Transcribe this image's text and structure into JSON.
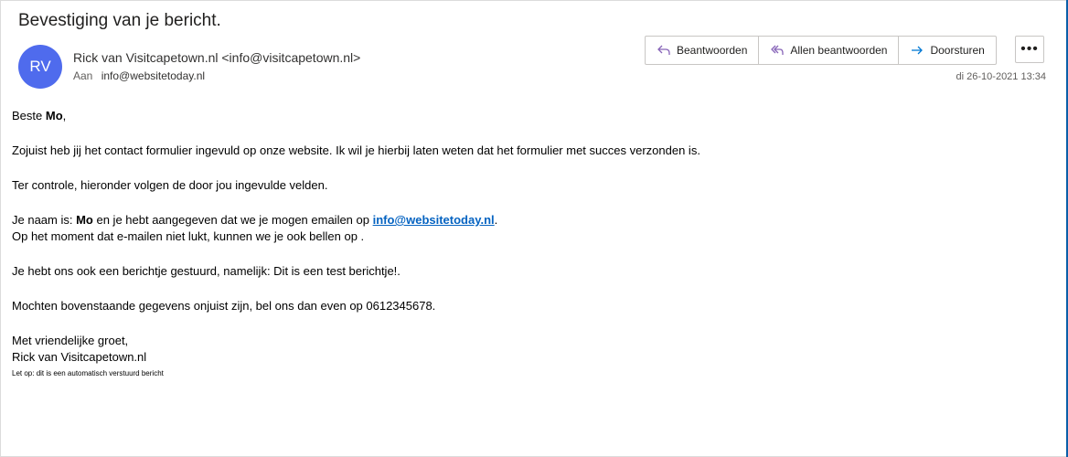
{
  "subject": "Bevestiging van je bericht.",
  "sender": {
    "initials": "RV",
    "display": "Rick van Visitcapetown.nl <info@visitcapetown.nl>",
    "to_label": "Aan",
    "to_address": "info@websitetoday.nl",
    "date": "di 26-10-2021 13:34"
  },
  "actions": {
    "reply": "Beantwoorden",
    "reply_all": "Allen beantwoorden",
    "forward": "Doorsturen",
    "more": "•••"
  },
  "colors": {
    "avatar": "#4f6bed",
    "reply_icon": "#8764b8",
    "forward_icon": "#0078d4",
    "link": "#0563c1"
  },
  "body": {
    "greeting_prefix": "Beste ",
    "name": "Mo",
    "greeting_suffix": ",",
    "line1": "Zojuist heb jij het contact formulier ingevuld op onze website. Ik wil je hierbij laten weten dat het formulier met succes verzonden is.",
    "line2": "Ter controle, hieronder volgen de door jou ingevulde velden.",
    "naam_prefix": "Je naam is: ",
    "naam_mid": " en je hebt aangegeven dat we je mogen emailen op ",
    "email_link": "info@websitetoday.nl",
    "naam_suffix": ".",
    "line4": "Op het moment dat e-mailen niet lukt, kunnen we je ook bellen op .",
    "line5": "Je hebt ons ook een berichtje gestuurd, namelijk: Dit is een test berichtje!.",
    "line6": "Mochten bovenstaande gegevens onjuist zijn, bel ons dan even op 0612345678.",
    "closing": "Met vriendelijke groet,",
    "signature": "Rick van Visitcapetown.nl",
    "footnote": "Let op: dit is een automatisch verstuurd bericht"
  }
}
